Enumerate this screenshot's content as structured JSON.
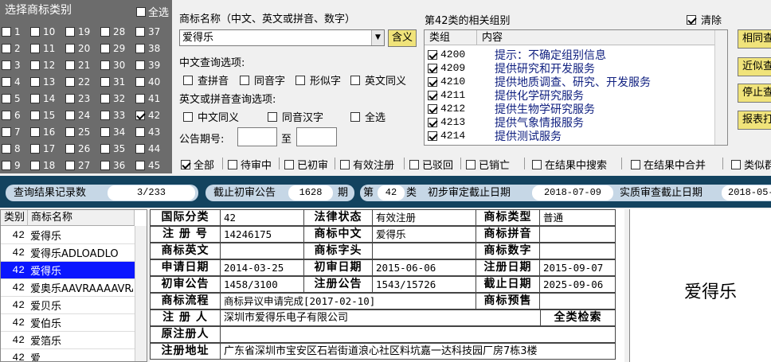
{
  "class_panel": {
    "title": "选择商标类别",
    "select_all": "全选",
    "classes": [
      [
        "1",
        "10",
        "19",
        "28",
        "37"
      ],
      [
        "2",
        "11",
        "20",
        "29",
        "38"
      ],
      [
        "3",
        "12",
        "21",
        "30",
        "39"
      ],
      [
        "4",
        "13",
        "22",
        "31",
        "40"
      ],
      [
        "5",
        "14",
        "23",
        "32",
        "41"
      ],
      [
        "6",
        "15",
        "24",
        "33",
        "42"
      ],
      [
        "7",
        "16",
        "25",
        "34",
        "43"
      ],
      [
        "8",
        "17",
        "26",
        "35",
        "44"
      ],
      [
        "9",
        "18",
        "27",
        "36",
        "45"
      ]
    ],
    "checked": "42"
  },
  "search": {
    "name_label": "商标名称（中文、英文或拼音、数字）",
    "name_value": "爱得乐",
    "meaning_button": "含义",
    "cn_options_label": "中文查询选项:",
    "cn_options": [
      "查拼音",
      "同音字",
      "形似字",
      "英文同义"
    ],
    "en_options_label": "英文或拼音查询选项:",
    "en_options": [
      "中文同义",
      "同音汉字",
      "全选"
    ],
    "notice_label": "公告期号:",
    "notice_to": "至"
  },
  "groups": {
    "title": "第42类的相关组别",
    "clear_label": "清除",
    "col_group": "类组",
    "col_content": "内容",
    "rows": [
      {
        "code": "4200",
        "text": "提示：不确定组别信息"
      },
      {
        "code": "4209",
        "text": "提供研究和开发服务"
      },
      {
        "code": "4210",
        "text": "提供地质调查、研究、开发服务"
      },
      {
        "code": "4211",
        "text": "提供化学研究服务"
      },
      {
        "code": "4212",
        "text": "提供生物学研究服务"
      },
      {
        "code": "4213",
        "text": "提供气象情报服务"
      },
      {
        "code": "4214",
        "text": "提供测试服务"
      }
    ]
  },
  "side_buttons": [
    "相同查",
    "近似查",
    "停止查",
    "报表打"
  ],
  "filters": [
    "全部",
    "待审中",
    "已初审",
    "有效注册",
    "已驳回",
    "已销亡",
    "在结果中搜索",
    "在结果中合并",
    "类似群"
  ],
  "status": {
    "count_label": "查询结果记录数",
    "count_value": "3/233",
    "deadline_label": "截止初审公告",
    "deadline_value": "1628",
    "period_suffix": "期",
    "class_prefix": "第",
    "class_value": "42",
    "class_suffix": "类",
    "prelim_label": "初步审定截止日期",
    "prelim_value": "2018-07-09",
    "exam_label": "实质审查截止日期",
    "exam_value": "2018-05-"
  },
  "results": {
    "col_class": "类别",
    "col_name": "商标名称",
    "rows": [
      {
        "cls": "42",
        "name": "爱得乐"
      },
      {
        "cls": "42",
        "name": "爱得乐ADLOADLO"
      },
      {
        "cls": "42",
        "name": "爱得乐"
      },
      {
        "cls": "42",
        "name": "爱奥乐AAVRAAAAVRAA"
      },
      {
        "cls": "42",
        "name": "爱贝乐"
      },
      {
        "cls": "42",
        "name": "爱伯乐"
      },
      {
        "cls": "42",
        "name": "爱箔乐"
      },
      {
        "cls": "42",
        "name": "爱"
      }
    ],
    "selected": 2
  },
  "detail": {
    "k_class": "国际分类",
    "v_class": "42",
    "k_legal": "法律状态",
    "v_legal": "有效注册",
    "k_type": "商标类型",
    "v_type": "普通",
    "k_regno": "注 册 号",
    "v_regno": "14246175",
    "k_cn": "商标中文",
    "v_cn": "爱得乐",
    "k_pinyin": "商标拼音",
    "v_pinyin": "",
    "k_en": "商标英文",
    "v_en": "",
    "k_head": "商标字头",
    "v_head": "",
    "k_digit": "商标数字",
    "v_digit": "",
    "k_apply": "申请日期",
    "v_apply": "2014-03-25",
    "k_prelimdate": "初审日期",
    "v_prelimdate": "2015-06-06",
    "k_regdate": "注册日期",
    "v_regdate": "2015-09-07",
    "k_prelimno": "初审公告",
    "v_prelimno": "1458/3100",
    "k_regnotice": "注册公告",
    "v_regnotice": "1543/15726",
    "k_end": "截止日期",
    "v_end": "2025-09-06",
    "k_flow": "商标流程",
    "v_flow": "商标异议申请完成[2017-02-10]",
    "k_warn": "商标预售",
    "v_warn": "",
    "k_owner": "注 册 人",
    "v_owner": "深圳市爱得乐电子有限公司",
    "all_search": "全类检索",
    "k_orig": "原注册人",
    "v_orig": "",
    "k_addr": "注册地址",
    "v_addr": "广东省深圳市宝安区石岩街道浪心社区料坑嘉一达科技园厂房7栋3楼"
  },
  "preview": {
    "text": "爱得乐"
  }
}
